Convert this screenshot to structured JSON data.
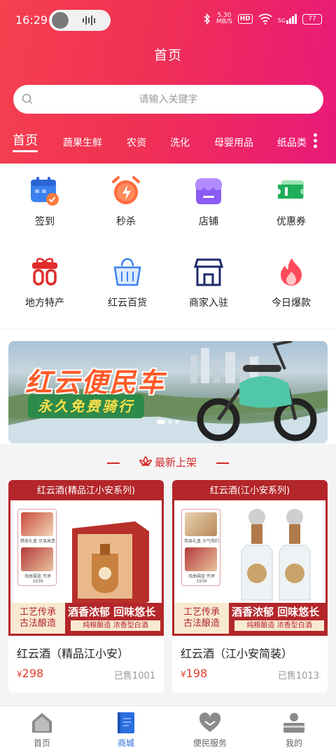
{
  "status_bar": {
    "time": "16:29",
    "net_speed_value": "5.30",
    "net_speed_unit": "MB/S",
    "hd": "HD",
    "signal": "5G",
    "battery": "77"
  },
  "header": {
    "title": "首页"
  },
  "search": {
    "placeholder": "请输入关键字"
  },
  "tabs": [
    "首页",
    "蔬果生鲜",
    "农资",
    "洗化",
    "母婴用品",
    "纸品类"
  ],
  "quick_entries": [
    {
      "label": "签到",
      "icon": "calendar-check-icon"
    },
    {
      "label": "秒杀",
      "icon": "alarm-clock-lightning-icon"
    },
    {
      "label": "店铺",
      "icon": "shop-icon"
    },
    {
      "label": "优惠券",
      "icon": "coupon-ticket-icon"
    },
    {
      "label": "地方特产",
      "icon": "gift-box-icon"
    },
    {
      "label": "红云百货",
      "icon": "shopping-basket-icon"
    },
    {
      "label": "商家入驻",
      "icon": "storefront-icon"
    },
    {
      "label": "今日爆款",
      "icon": "flame-icon"
    }
  ],
  "banner": {
    "title": "红云便民车",
    "subtitle": "永久免费骑行"
  },
  "section": {
    "title": "最新上架"
  },
  "products": [
    {
      "header": "红云酒(精品江小安系列)",
      "thumb_caption_1": "精美礼盒 尽显高贵",
      "thumb_caption_2": "戏曲福蓝 传承1939",
      "craft_line1": "工艺传承",
      "craft_line2": "古法酿造",
      "slogan": "酒香浓郁 回味悠长",
      "sub_slogan": "纯粮酿造 浓香型白酒",
      "name": "红云酒（精品江小安）",
      "currency": "¥",
      "price": "298",
      "sold": "已售1001"
    },
    {
      "header": "红云酒(江小安系列)",
      "thumb_caption_1": "简易礼盒 大气简约",
      "thumb_caption_2": "戏曲福蓝 传承1939",
      "craft_line1": "工艺传承",
      "craft_line2": "古法酿造",
      "slogan": "酒香浓郁 回味悠长",
      "sub_slogan": "纯粮酿造 浓香型白酒",
      "name": "红云酒（江小安简装）",
      "currency": "¥",
      "price": "198",
      "sold": "已售1013"
    }
  ],
  "bottom_nav": [
    {
      "label": "首页",
      "icon": "home-icon",
      "active": false
    },
    {
      "label": "商城",
      "icon": "mall-book-icon",
      "active": true
    },
    {
      "label": "便民服务",
      "icon": "heart-service-icon",
      "active": false
    },
    {
      "label": "我的",
      "icon": "profile-card-icon",
      "active": false
    }
  ],
  "colors": {
    "header_start": "#f5404f",
    "header_end": "#e8197a",
    "price": "#e33b2a",
    "wine_red": "#b3262a",
    "nav_active": "#2a6ee0"
  }
}
